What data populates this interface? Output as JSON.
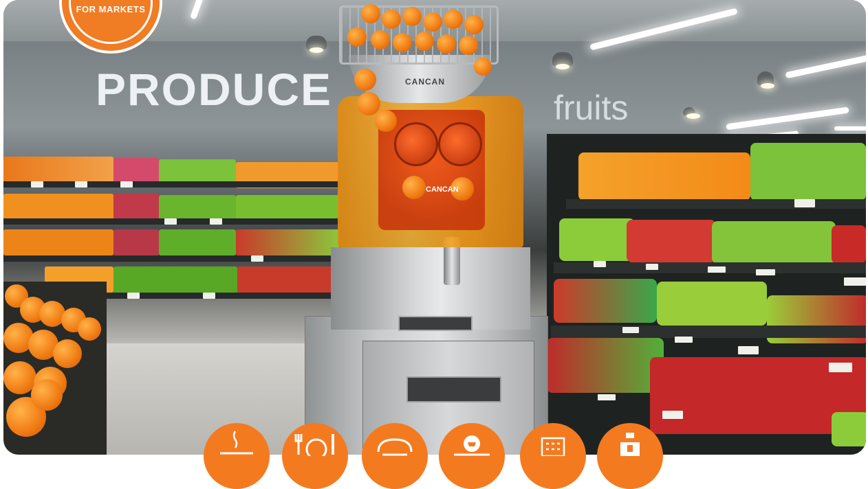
{
  "badge": {
    "label": "FOR MARKETS"
  },
  "scene": {
    "sign_left": "PRODUCE",
    "sign_right": "fruits",
    "machine_logo_top": "CANCAN",
    "machine_logo_front": "CANCAN"
  },
  "categories": [
    {
      "icon": "coffee-cup-icon"
    },
    {
      "icon": "restaurant-icon"
    },
    {
      "icon": "bakery-icon"
    },
    {
      "icon": "market-cart-icon"
    },
    {
      "icon": "hotel-building-icon"
    },
    {
      "icon": "shop-icon"
    }
  ],
  "colors": {
    "accent": "#f47a20",
    "badge": "#f07c24"
  }
}
